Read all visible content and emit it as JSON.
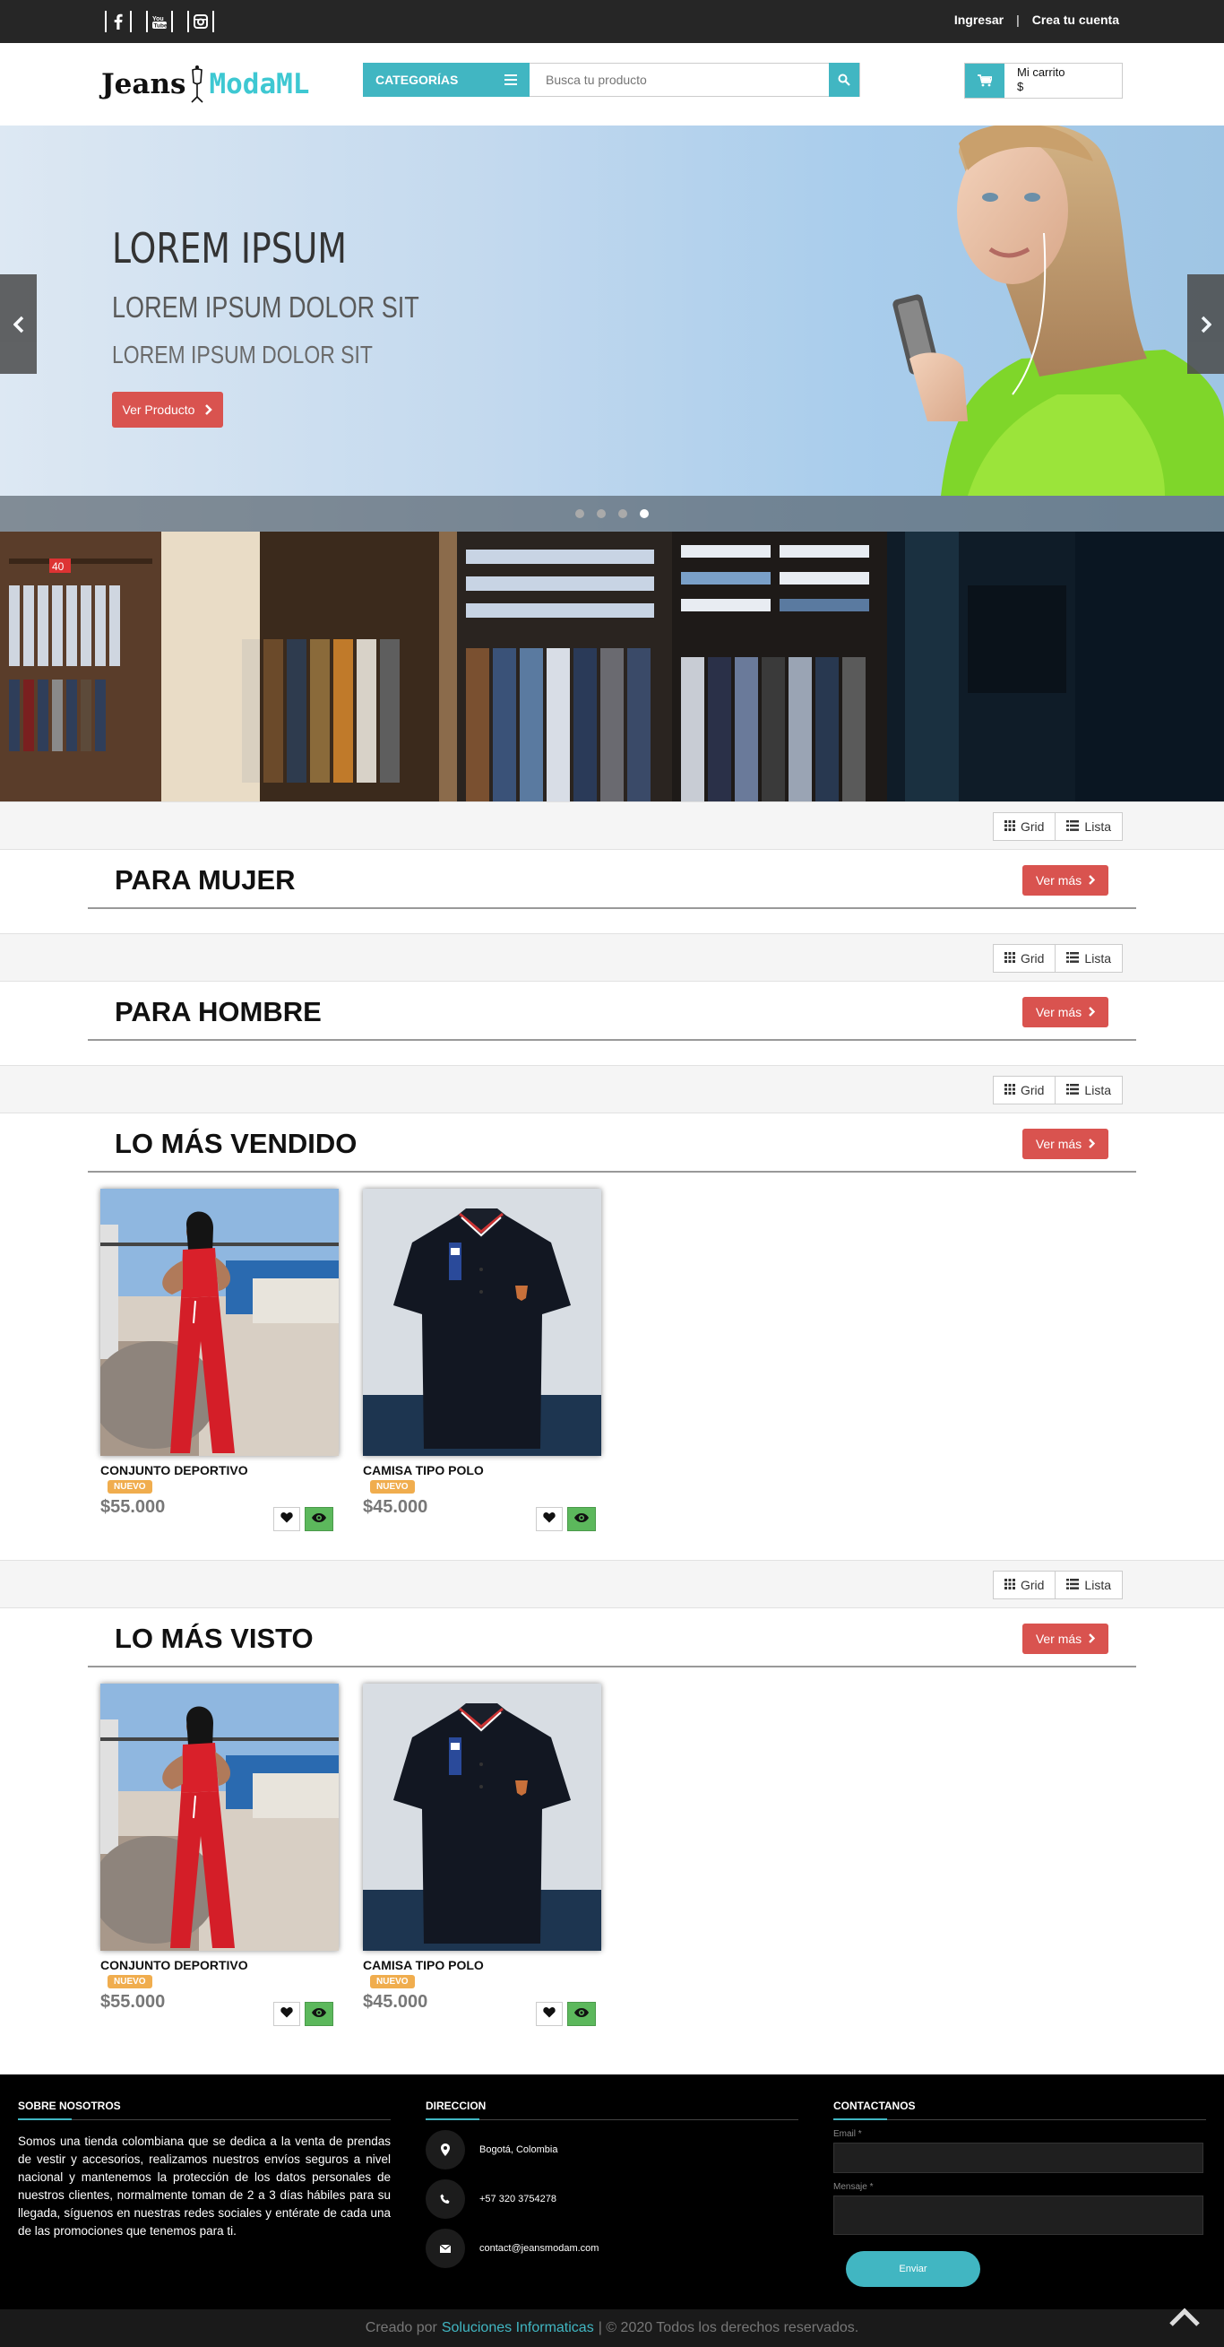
{
  "topbar": {
    "social": [
      {
        "icon": "facebook-icon"
      },
      {
        "icon": "youtube-icon"
      },
      {
        "icon": "instagram-icon"
      }
    ],
    "login_label": "Ingresar",
    "separator": "|",
    "register_label": "Crea tu cuenta"
  },
  "header": {
    "logo_part1": "Jeans",
    "logo_part2": "ModaML",
    "categories_label": "CATEGORÍAS",
    "search_placeholder": "Busca tu producto",
    "cart_title": "Mi carrito",
    "cart_total": "$"
  },
  "hero": {
    "title": "LOREM IPSUM",
    "subtitle": "LOREM IPSUM DOLOR SIT",
    "subtitle2": "LOREM IPSUM DOLOR SIT",
    "button_label": "Ver Producto",
    "slide_count": 4,
    "active_slide": 4
  },
  "view_toggle": {
    "grid_label": "Grid",
    "list_label": "Lista"
  },
  "sections": [
    {
      "title": "PARA MUJER",
      "more_label": "Ver más",
      "products": []
    },
    {
      "title": "PARA HOMBRE",
      "more_label": "Ver más",
      "products": []
    },
    {
      "title": "LO MÁS VENDIDO",
      "more_label": "Ver más",
      "products": [
        {
          "name": "CONJUNTO DEPORTIVO",
          "badge": "NUEVO",
          "price": "$55.000"
        },
        {
          "name": "CAMISA TIPO POLO",
          "badge": "NUEVO",
          "price": "$45.000"
        }
      ]
    },
    {
      "title": "LO MÁS VISTO",
      "more_label": "Ver más",
      "products": [
        {
          "name": "CONJUNTO DEPORTIVO",
          "badge": "NUEVO",
          "price": "$55.000"
        },
        {
          "name": "CAMISA TIPO POLO",
          "badge": "NUEVO",
          "price": "$45.000"
        }
      ]
    }
  ],
  "footer": {
    "about_title": "SOBRE NOSOTROS",
    "about_text": "Somos una tienda colombiana que se dedica a la venta de prendas de vestir y accesorios, realizamos nuestros envíos seguros a nivel nacional y mantenemos la protección de los datos personales de nuestros clientes, normalmente toman de 2 a 3 días hábiles para su llegada, síguenos en nuestras redes sociales y entérate de cada una de las promociones que tenemos para ti.",
    "address_title": "DIRECCION",
    "address": "Bogotá, Colombia",
    "phone": "+57 320 3754278",
    "email": "contact@jeansmodam.com",
    "contact_title": "CONTACTANOS",
    "email_label": "Email *",
    "message_label": "Mensaje *",
    "send_label": "Enviar"
  },
  "bottom": {
    "created_by": "Creado por",
    "brand": "Soluciones Informaticas",
    "rights": "| © 2020 Todos los derechos reservados."
  },
  "colors": {
    "accent": "#41b6c2",
    "button_red": "#d9534f",
    "badge_orange": "#f0ad4e",
    "view_green": "#5cb85c"
  }
}
